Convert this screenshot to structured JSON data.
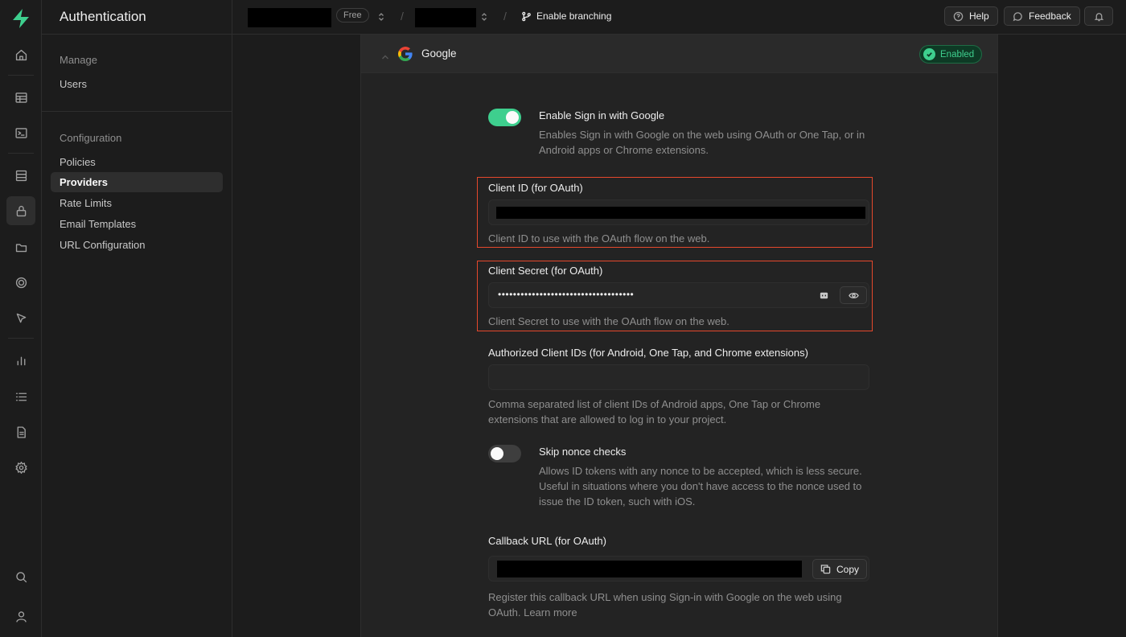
{
  "sidebar": {
    "title": "Authentication",
    "groups": [
      {
        "title": "Manage",
        "items": [
          "Users"
        ]
      },
      {
        "title": "Configuration",
        "items": [
          "Policies",
          "Providers",
          "Rate Limits",
          "Email Templates",
          "URL Configuration"
        ]
      }
    ],
    "active_item": "Providers"
  },
  "rail": {
    "icons": [
      "home-icon",
      "table-editor-icon",
      "sql-editor-icon",
      "database-icon",
      "authentication-icon",
      "storage-icon",
      "realtime-icon",
      "edge-functions-icon",
      "reports-icon",
      "logs-icon",
      "api-docs-icon",
      "settings-icon",
      "search-icon",
      "user-icon"
    ],
    "active_icon": "authentication-icon"
  },
  "topbar": {
    "plan_badge": "Free",
    "branching_label": "Enable branching",
    "help_label": "Help",
    "feedback_label": "Feedback"
  },
  "provider": {
    "name": "Google",
    "status": "Enabled",
    "enable_toggle": {
      "label": "Enable Sign in with Google",
      "description": "Enables Sign in with Google on the web using OAuth or One Tap, or in Android apps or Chrome extensions.",
      "on": true
    },
    "client_id": {
      "label": "Client ID (for OAuth)",
      "help": "Client ID to use with the OAuth flow on the web."
    },
    "client_secret": {
      "label": "Client Secret (for OAuth)",
      "masked_value": "••••••••••••••••••••••••••••••••••••",
      "help": "Client Secret to use with the OAuth flow on the web."
    },
    "authorized_client_ids": {
      "label": "Authorized Client IDs (for Android, One Tap, and Chrome extensions)",
      "value": "",
      "help": "Comma separated list of client IDs of Android apps, One Tap or Chrome extensions that are allowed to log in to your project."
    },
    "skip_nonce": {
      "label": "Skip nonce checks",
      "description": "Allows ID tokens with any nonce to be accepted, which is less secure. Useful in situations where you don't have access to the nonce used to issue the ID token, such with iOS.",
      "on": false
    },
    "callback_url": {
      "label": "Callback URL (for OAuth)",
      "copy_label": "Copy",
      "help": "Register this callback URL when using Sign-in with Google on the web using OAuth.",
      "link": "Learn more"
    }
  },
  "colors": {
    "brand_green": "#3ecf8e",
    "highlight_red": "#e5482c",
    "background": "#1c1c1c"
  }
}
